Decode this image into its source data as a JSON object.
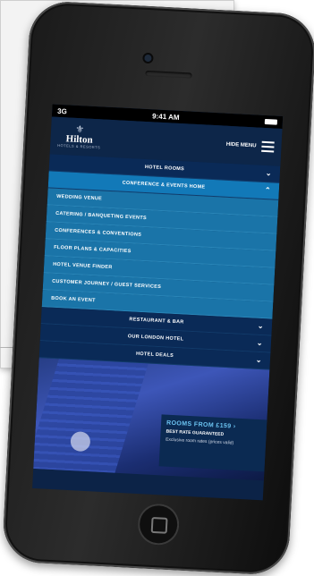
{
  "status_bar": {
    "carrier": "3G",
    "time": "9:41 AM"
  },
  "header": {
    "brand": "Hilton",
    "brand_sub": "HOTELS & RESORTS",
    "menu_label": "HIDE MENU"
  },
  "menu": {
    "hotel_rooms": "HOTEL ROOMS",
    "conference": "CONFERENCE & EVENTS HOME",
    "sub_items": [
      "WEDDING VENUE",
      "CATERING / BANQUETING EVENTS",
      "CONFERENCES & CONVENTIONS",
      "FLOOR PLANS & CAPACITIES",
      "HOTEL VENUE FINDER",
      "CUSTOMER JOURNEY / GUEST SERVICES",
      "BOOK AN EVENT"
    ],
    "restaurant": "RESTAURANT & BAR",
    "london_hotel": "OUR LONDON HOTEL",
    "hotel_deals": "HOTEL DEALS"
  },
  "promo": {
    "title": "ROOMS FROM £159 ›",
    "line2": "BEST RATE GUARANTEED",
    "line3": "Exclusive room rates (prices valid)"
  },
  "colors": {
    "navy": "#0c2347",
    "menu_open": "#1279b8",
    "promo_accent": "#6cc4f2"
  }
}
